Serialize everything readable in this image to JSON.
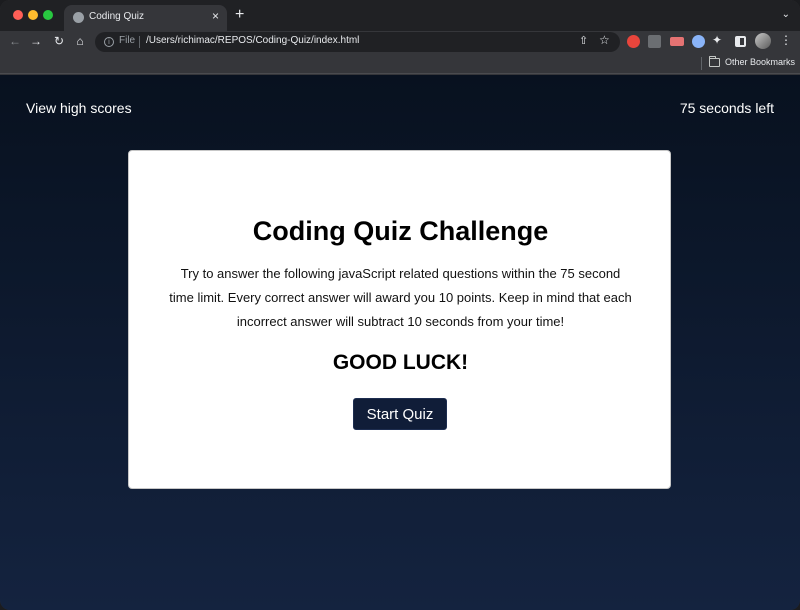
{
  "browser": {
    "tab_title": "Coding Quiz",
    "tab_close": "×",
    "new_tab": "+",
    "tab_menu": "⌄",
    "url_scheme": "File",
    "url": "/Users/richimac/REPOS/Coding-Quiz/index.html",
    "bookmark_folder": "Other Bookmarks",
    "icons": [
      "back-icon",
      "forward-icon",
      "reload-icon",
      "home-icon",
      "info-icon",
      "share-icon",
      "star-icon",
      "puzzle-icon",
      "side-panel-icon",
      "profile-avatar",
      "menu-icon",
      "folder-icon"
    ]
  },
  "page": {
    "high_scores_link": "View high scores",
    "timer_text": "75 seconds left",
    "title": "Coding Quiz Challenge",
    "description": "Try to answer the following javaScript related questions within the 75 second time limit. Every correct answer will award you 10 points. Keep in mind that each incorrect answer will subtract 10 seconds from your time!",
    "good_luck": "GOOD LUCK!",
    "start_button": "Start Quiz"
  },
  "colors": {
    "page_background": "#0b1526",
    "card_background": "#ffffff",
    "button_background": "#101d38",
    "browser_chrome": "#35363a"
  }
}
